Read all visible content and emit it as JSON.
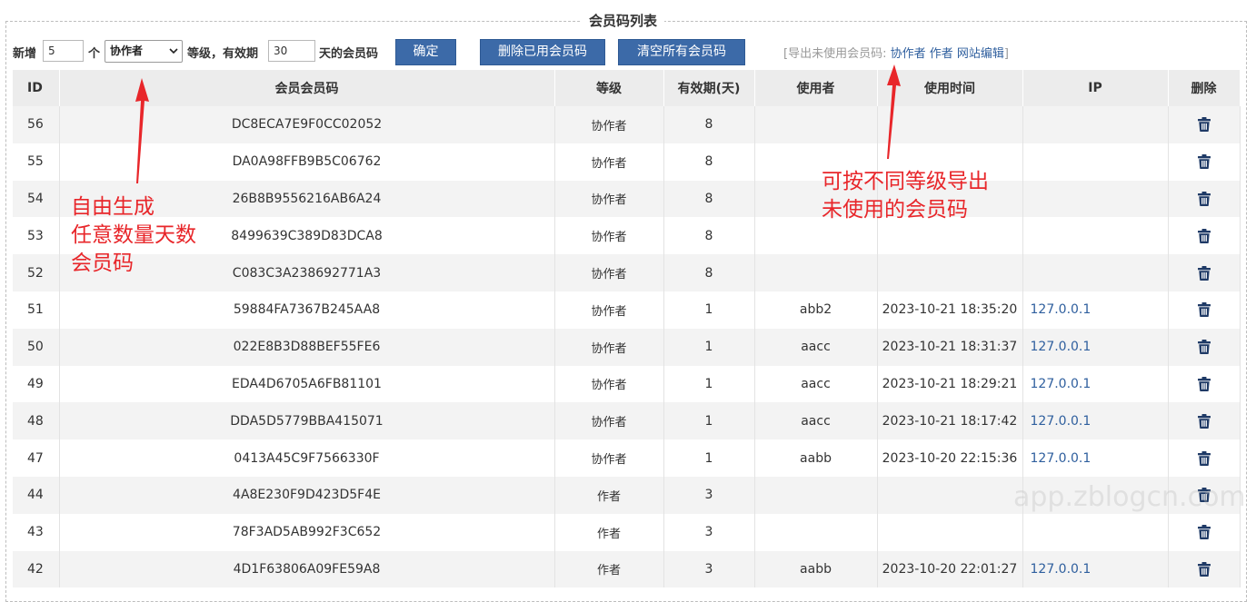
{
  "title": "会员码列表",
  "toolbar": {
    "add_label": "新增",
    "count_value": "5",
    "unit_label": "个",
    "level_selected": "协作者",
    "level_suffix": "等级，有效期",
    "days_value": "30",
    "days_suffix": "天的会员码",
    "confirm_label": "确定",
    "delete_used_label": "删除已用会员码",
    "clear_all_label": "清空所有会员码",
    "export_prefix": "[导出未使用会员码:",
    "export_links": [
      "协作者",
      "作者",
      "网站编辑"
    ],
    "export_suffix": "]"
  },
  "table": {
    "headers": [
      "ID",
      "会员会员码",
      "等级",
      "有效期(天)",
      "使用者",
      "使用时间",
      "IP",
      "删除"
    ],
    "rows": [
      {
        "id": "56",
        "code": "DC8ECA7E9F0CC02052",
        "level": "协作者",
        "days": "8",
        "user": "",
        "time": "",
        "ip": ""
      },
      {
        "id": "55",
        "code": "DA0A98FFB9B5C06762",
        "level": "协作者",
        "days": "8",
        "user": "",
        "time": "",
        "ip": ""
      },
      {
        "id": "54",
        "code": "26B8B9556216AB6A24",
        "level": "协作者",
        "days": "8",
        "user": "",
        "time": "",
        "ip": ""
      },
      {
        "id": "53",
        "code": "8499639C389D83DCA8",
        "level": "协作者",
        "days": "8",
        "user": "",
        "time": "",
        "ip": ""
      },
      {
        "id": "52",
        "code": "C083C3A238692771A3",
        "level": "协作者",
        "days": "8",
        "user": "",
        "time": "",
        "ip": ""
      },
      {
        "id": "51",
        "code": "59884FA7367B245AA8",
        "level": "协作者",
        "days": "1",
        "user": "abb2",
        "time": "2023-10-21 18:35:20",
        "ip": "127.0.0.1"
      },
      {
        "id": "50",
        "code": "022E8B3D88BEF55FE6",
        "level": "协作者",
        "days": "1",
        "user": "aacc",
        "time": "2023-10-21 18:31:37",
        "ip": "127.0.0.1"
      },
      {
        "id": "49",
        "code": "EDA4D6705A6FB81101",
        "level": "协作者",
        "days": "1",
        "user": "aacc",
        "time": "2023-10-21 18:29:21",
        "ip": "127.0.0.1"
      },
      {
        "id": "48",
        "code": "DDA5D5779BBA415071",
        "level": "协作者",
        "days": "1",
        "user": "aacc",
        "time": "2023-10-21 18:17:42",
        "ip": "127.0.0.1"
      },
      {
        "id": "47",
        "code": "0413A45C9F7566330F",
        "level": "协作者",
        "days": "1",
        "user": "aabb",
        "time": "2023-10-20 22:15:36",
        "ip": "127.0.0.1"
      },
      {
        "id": "44",
        "code": "4A8E230F9D423D5F4E",
        "level": "作者",
        "days": "3",
        "user": "",
        "time": "",
        "ip": ""
      },
      {
        "id": "43",
        "code": "78F3AD5AB992F3C652",
        "level": "作者",
        "days": "3",
        "user": "",
        "time": "",
        "ip": ""
      },
      {
        "id": "42",
        "code": "4D1F63806A09FE59A8",
        "level": "作者",
        "days": "3",
        "user": "aabb",
        "time": "2023-10-20 22:01:27",
        "ip": "127.0.0.1"
      }
    ]
  },
  "annotations": {
    "left": [
      "自由生成",
      "任意数量天数",
      "会员码"
    ],
    "right": [
      "可按不同等级导出",
      "未使用的会员码"
    ]
  },
  "watermark": "app.zblogcn.com",
  "colors": {
    "button_bg": "#3c6aa8",
    "link": "#2f5f9e",
    "annotation": "#e8262a",
    "trash_icon": "#1f3a66"
  }
}
